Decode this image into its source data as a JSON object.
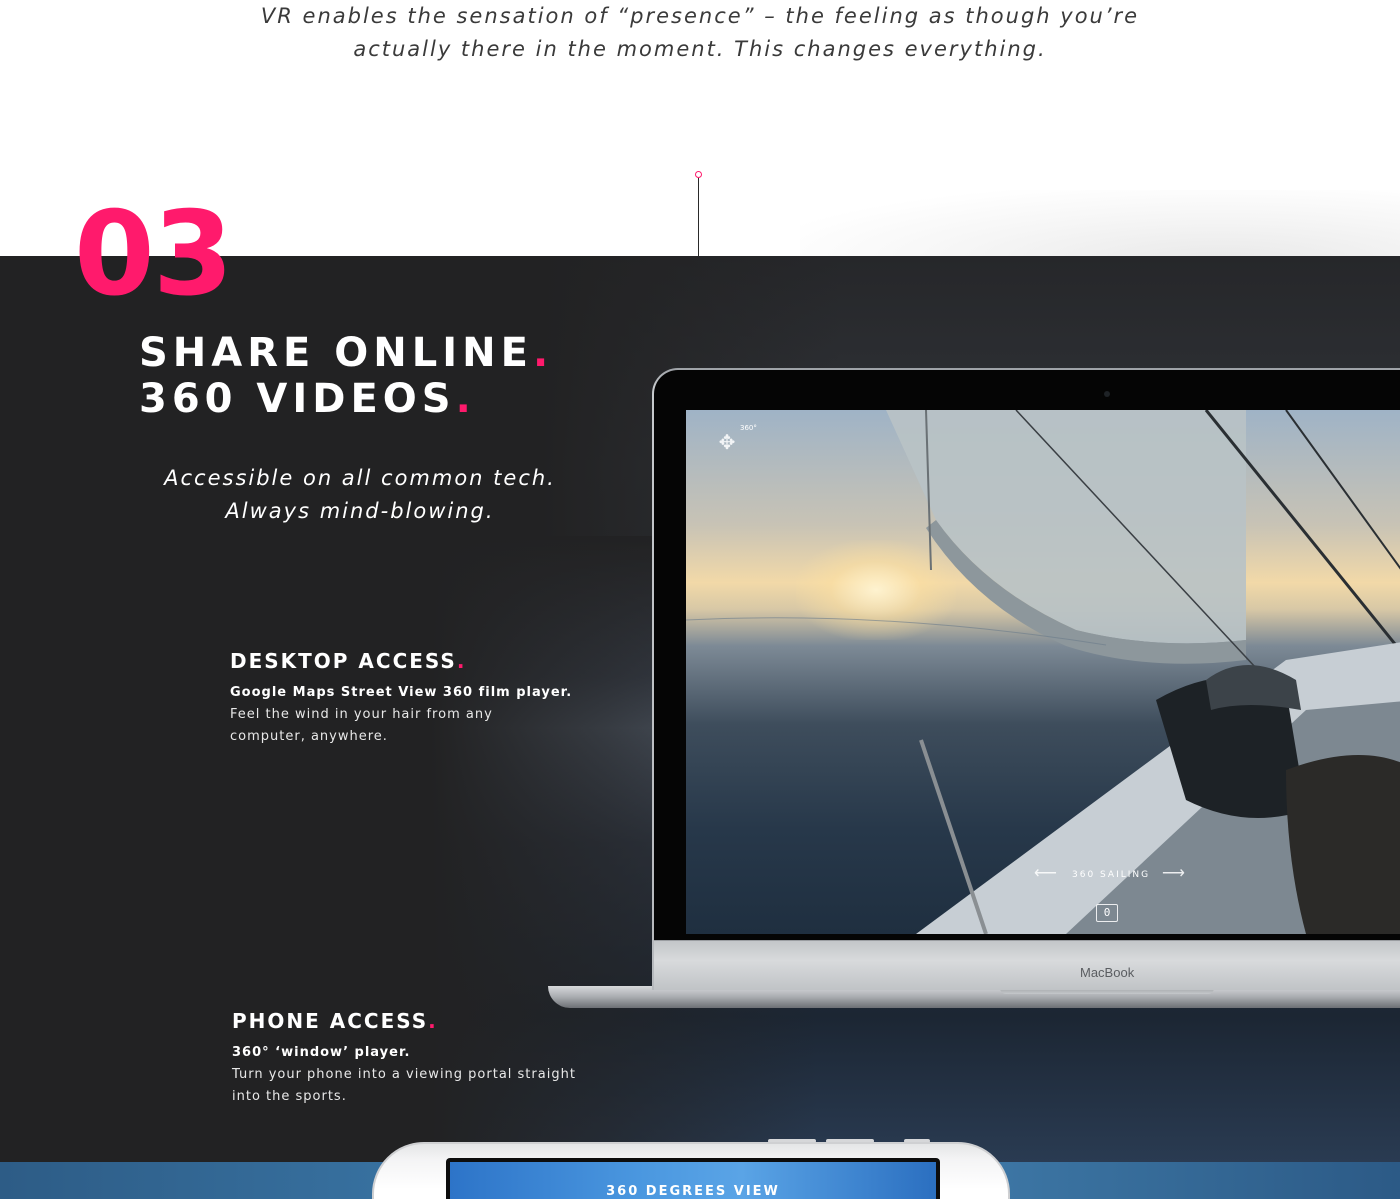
{
  "intro": {
    "quote_line1": "VR enables the sensation of “presence” – the feeling as though you’re",
    "quote_line2": "actually there in the moment. This changes everything."
  },
  "section": {
    "number": "03",
    "title_line1": "SHARE ONLINE",
    "title_line2": "360 VIDEOS",
    "title_punct": ".",
    "tagline_line1": "Accessible on all common tech.",
    "tagline_line2": "Always mind-blowing."
  },
  "features": {
    "desktop": {
      "title": "DESKTOP ACCESS",
      "subtitle": "Google Maps Street View 360 film player.",
      "desc_line1": "Feel the wind in your hair from any",
      "desc_line2": "computer, anywhere."
    },
    "phone": {
      "title": "PHONE ACCESS",
      "subtitle": "360° ‘window’ player.",
      "desc_line1": "Turn your phone into a viewing portal straight",
      "desc_line2": "into the sports."
    }
  },
  "laptop": {
    "brand": "MacBook",
    "player": {
      "badge": "360°",
      "move_icon": "move-arrows-icon",
      "caption": "360 SAILING",
      "prev_icon": "arrow-left-icon",
      "next_icon": "arrow-right-icon",
      "vr_icon": "vr-mode-icon"
    }
  },
  "phone_device": {
    "label": "360 DEGREES VIEW"
  },
  "colors": {
    "accent": "#ff1a6c",
    "dark_bg": "#222223",
    "text_light": "#ffffff",
    "text_dark": "#3a3a3a"
  }
}
